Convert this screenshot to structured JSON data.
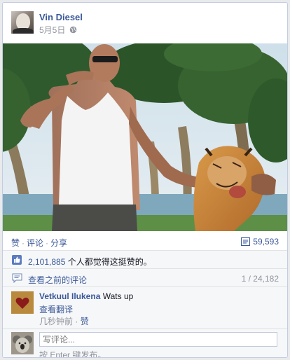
{
  "post": {
    "author": "Vin Diesel",
    "date": "5月5日",
    "privacy_icon": "globe-icon"
  },
  "actions": {
    "like": "赞",
    "comment": "评论",
    "share": "分享",
    "share_count": "59,593"
  },
  "ufi": {
    "likes_count": "2,101,885",
    "likes_text": " 个人都觉得这挺赞的。",
    "view_previous": "查看之前的评论",
    "pagination": "1 / 24,182"
  },
  "comment": {
    "author": "Vetkuul Ilukena",
    "text": "Wats up",
    "translate": "查看翻译",
    "time": "几秒钟前",
    "sep": " · ",
    "like": "赞"
  },
  "composer": {
    "placeholder": "写评论...",
    "hint": "按 Enter 键发布。"
  },
  "colors": {
    "link": "#3b5998",
    "meta": "#90949c",
    "ufi_bg": "#f6f7f9"
  }
}
